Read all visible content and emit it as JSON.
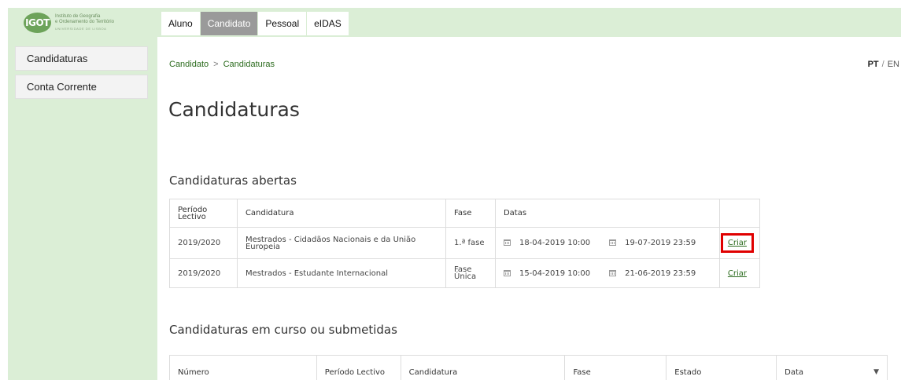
{
  "logo": {
    "mark": "IGOT",
    "line1": "Instituto de Geografia",
    "line2": "e Ordenamento do Território",
    "line3": "UNIVERSIDADE DE LISBOA"
  },
  "tabs": [
    {
      "label": "Aluno",
      "active": false
    },
    {
      "label": "Candidato",
      "active": true
    },
    {
      "label": "Pessoal",
      "active": false
    },
    {
      "label": "eIDAS",
      "active": false
    }
  ],
  "sidebar": {
    "items": [
      {
        "label": "Candidaturas"
      },
      {
        "label": "Conta Corrente"
      }
    ]
  },
  "breadcrumb": {
    "root": "Candidato",
    "separator": ">",
    "current": "Candidaturas"
  },
  "language": {
    "current": "PT",
    "separator": "/",
    "other": "EN"
  },
  "page_title": "Candidaturas",
  "open_section": {
    "title": "Candidaturas abertas",
    "headers": {
      "periodo": "Período Lectivo",
      "candidatura": "Candidatura",
      "fase": "Fase",
      "datas": "Datas"
    },
    "rows": [
      {
        "periodo": "2019/2020",
        "candidatura": "Mestrados - Cidadãos Nacionais e da União Europeia",
        "fase": "1.ª fase",
        "inicio": "18-04-2019 10:00",
        "fim": "19-07-2019 23:59",
        "action": "Criar"
      },
      {
        "periodo": "2019/2020",
        "candidatura": "Mestrados - Estudante Internacional",
        "fase": "Fase Única",
        "inicio": "15-04-2019 10:00",
        "fim": "21-06-2019 23:59",
        "action": "Criar"
      }
    ]
  },
  "progress_section": {
    "title": "Candidaturas em curso ou submetidas",
    "headers": {
      "numero": "Número",
      "periodo": "Período Lectivo",
      "candidatura": "Candidatura",
      "fase": "Fase",
      "estado": "Estado",
      "data": "Data"
    }
  },
  "colors": {
    "header_green": "#dbeed6",
    "link_green": "#2b6b1d",
    "active_tab": "#9a9a9a",
    "highlight_red": "#e00000"
  }
}
